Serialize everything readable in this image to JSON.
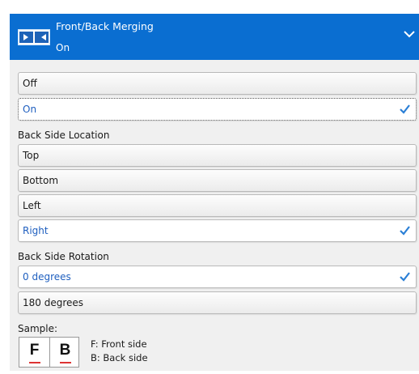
{
  "header": {
    "title": "Front/Back Merging",
    "value": "On",
    "icon": "front-back-merge-icon",
    "expand_icon": "chevron-down-icon",
    "accent_color": "#0a6ed1"
  },
  "merge_options": [
    {
      "label": "Off",
      "selected": false
    },
    {
      "label": "On",
      "selected": true
    }
  ],
  "back_side_location": {
    "label": "Back Side Location",
    "options": [
      {
        "label": "Top",
        "selected": false
      },
      {
        "label": "Bottom",
        "selected": false
      },
      {
        "label": "Left",
        "selected": false
      },
      {
        "label": "Right",
        "selected": true
      }
    ]
  },
  "back_side_rotation": {
    "label": "Back Side Rotation",
    "options": [
      {
        "label": "0 degrees",
        "selected": true
      },
      {
        "label": "180 degrees",
        "selected": false
      }
    ]
  },
  "sample": {
    "label": "Sample:",
    "front_letter": "F",
    "back_letter": "B",
    "front_legend": "F: Front side",
    "back_legend": "B: Back side"
  },
  "selection_color": "#1f5fbf"
}
